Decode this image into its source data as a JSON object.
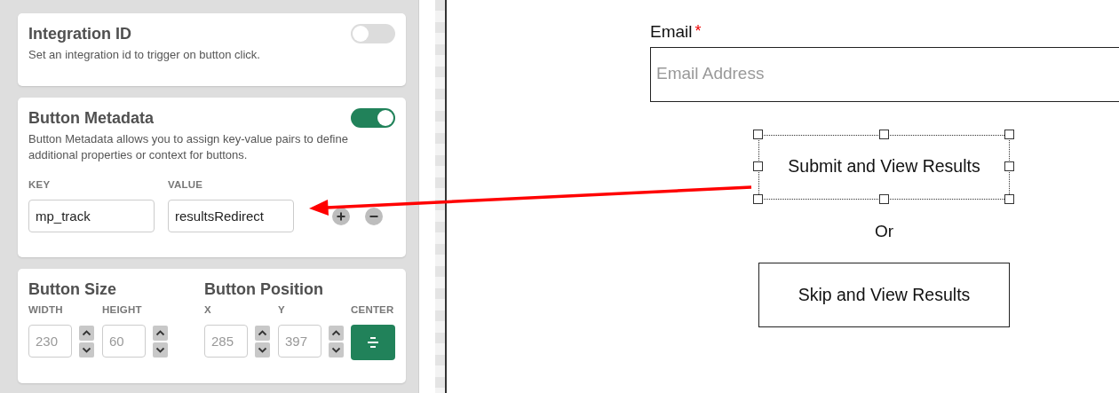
{
  "integration": {
    "title": "Integration ID",
    "description": "Set an integration id to trigger on button click.",
    "on": false
  },
  "metadata": {
    "title": "Button Metadata",
    "description": "Button Metadata allows you to assign key-value pairs to define additional properties or context for buttons.",
    "on": true,
    "key_label": "KEY",
    "value_label": "VALUE",
    "pairs": [
      {
        "key": "mp_track",
        "value": "resultsRedirect"
      }
    ]
  },
  "size": {
    "title": "Button Size",
    "fields": [
      {
        "label": "WIDTH",
        "value": "230"
      },
      {
        "label": "HEIGHT",
        "value": "60"
      }
    ]
  },
  "position": {
    "title": "Button Position",
    "fields": [
      {
        "label": "X",
        "value": "285"
      },
      {
        "label": "Y",
        "value": "397"
      }
    ],
    "center_label": "CENTER"
  },
  "canvas": {
    "email_label": "Email",
    "required_mark": "*",
    "email_placeholder": "Email Address",
    "separator": "Or",
    "buttons": [
      {
        "label": "Submit and View Results",
        "selected": true
      },
      {
        "label": "Skip and View Results",
        "selected": false
      }
    ]
  }
}
